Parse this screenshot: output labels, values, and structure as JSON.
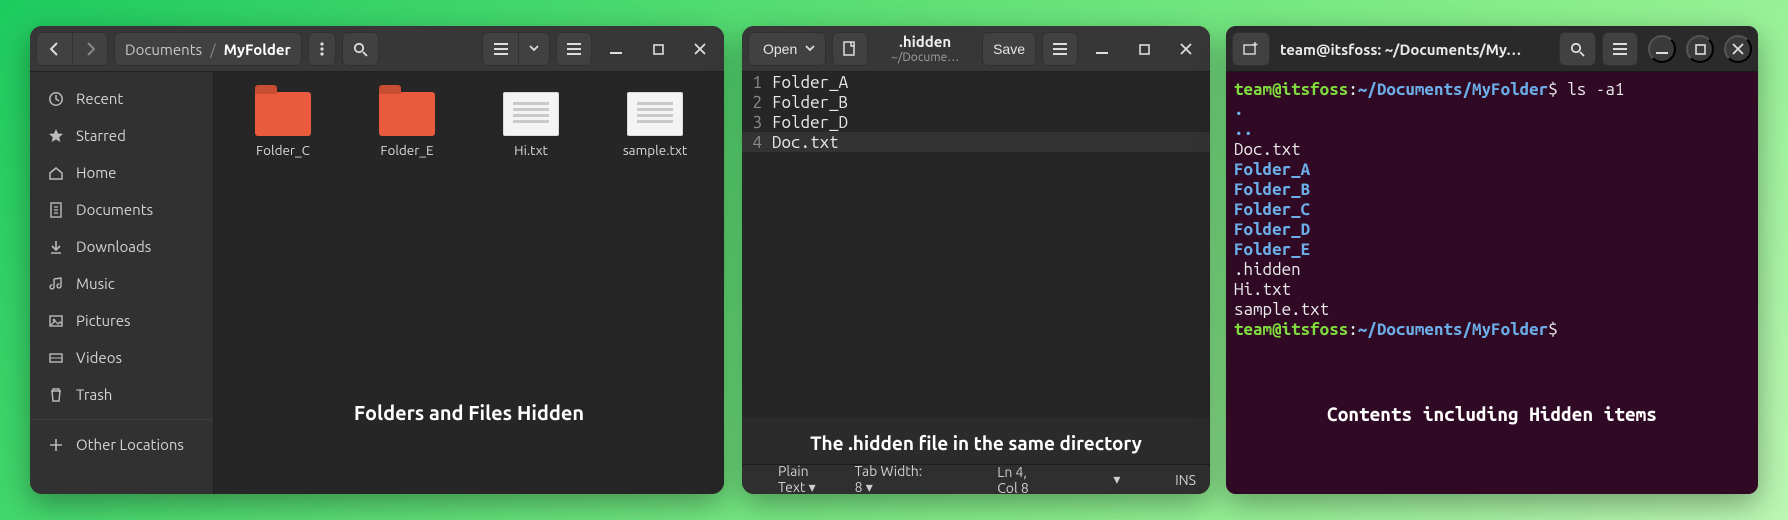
{
  "nautilus": {
    "path_segments": [
      "Documents",
      "MyFolder"
    ],
    "sidebar": [
      {
        "icon": "clock",
        "label": "Recent"
      },
      {
        "icon": "star",
        "label": "Starred"
      },
      {
        "icon": "home",
        "label": "Home"
      },
      {
        "icon": "doc",
        "label": "Documents"
      },
      {
        "icon": "download",
        "label": "Downloads"
      },
      {
        "icon": "music",
        "label": "Music"
      },
      {
        "icon": "image",
        "label": "Pictures"
      },
      {
        "icon": "video",
        "label": "Videos"
      },
      {
        "icon": "trash",
        "label": "Trash"
      }
    ],
    "other_locations": "Other Locations",
    "files": [
      {
        "kind": "folder",
        "name": "Folder_C"
      },
      {
        "kind": "folder",
        "name": "Folder_E"
      },
      {
        "kind": "file",
        "name": "Hi.txt"
      },
      {
        "kind": "file",
        "name": "sample.txt"
      }
    ],
    "caption": "Folders and Files Hidden"
  },
  "gedit": {
    "open_label": "Open",
    "save_label": "Save",
    "title": ".hidden",
    "subtitle": "~/Docume…",
    "lines": [
      "Folder_A",
      "Folder_B",
      "Folder_D",
      "Doc.txt"
    ],
    "cursor_line_index": 3,
    "caption": "The .hidden file in the same directory",
    "status": {
      "lang": "Plain Text",
      "tabwidth": "Tab Width: 8",
      "position": "Ln 4, Col 8",
      "insert": "INS"
    }
  },
  "terminal": {
    "title": "team@itsfoss: ~/Documents/My…",
    "prompt_user": "team@itsfoss",
    "prompt_path": "~/Documents/MyFolder",
    "command": "ls -a1",
    "output": [
      {
        "text": ".",
        "cls": "dir"
      },
      {
        "text": "..",
        "cls": "dir"
      },
      {
        "text": "Doc.txt",
        "cls": "plain"
      },
      {
        "text": "Folder_A",
        "cls": "dir"
      },
      {
        "text": "Folder_B",
        "cls": "dir"
      },
      {
        "text": "Folder_C",
        "cls": "dir"
      },
      {
        "text": "Folder_D",
        "cls": "dir"
      },
      {
        "text": "Folder_E",
        "cls": "dir"
      },
      {
        "text": ".hidden",
        "cls": "plain"
      },
      {
        "text": "Hi.txt",
        "cls": "plain"
      },
      {
        "text": "sample.txt",
        "cls": "plain"
      }
    ],
    "caption": "Contents including Hidden items"
  }
}
